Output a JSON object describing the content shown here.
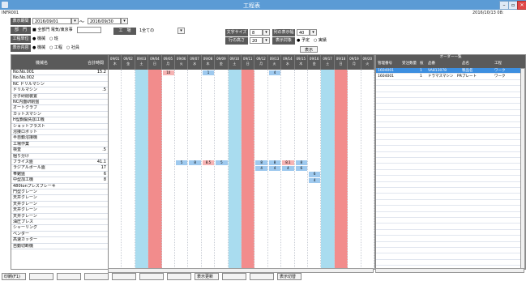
{
  "window": {
    "title": "工程表",
    "id": "INFR001",
    "datetime": "2016/10/13  08:"
  },
  "filters": {
    "period_label": "表示期間",
    "date_from": "2016/09/01",
    "tilde": "〜",
    "date_to": "2016/09/30",
    "dept_label": "部　門",
    "dept_options": "■ 全部門 電気/東京事",
    "dept_field": "",
    "factory_label": "工　場",
    "factory_value": "1全ての",
    "type_label": "工程単位",
    "type_options": "● 機械　○ 班",
    "display_label": "表示内容",
    "display_options": "● 機械　○ 工程　○ 社員",
    "font_label": "文字サイズ",
    "font_value": "8",
    "width_label": "列の表示幅",
    "width_value": "40",
    "rows_label": "行の高さ",
    "rows_value": "20",
    "target_label": "表示対象",
    "target_options": "● 予定　○ 実績",
    "show_button": "表示"
  },
  "left_grid": {
    "col_name": "機械名",
    "col_total": "合計時間",
    "rows": [
      {
        "name": "No.No.001",
        "total": "15.2"
      },
      {
        "name": "No.No.002",
        "total": ""
      },
      {
        "name": "NC ドリルマシン",
        "total": ""
      },
      {
        "name": "ドリルマシン",
        "total": ".5"
      },
      {
        "name": "分子研削装置",
        "total": ""
      },
      {
        "name": "NC内面研削盤",
        "total": ""
      },
      {
        "name": "オートクラブ",
        "total": ""
      },
      {
        "name": "カットスマシン",
        "total": ""
      },
      {
        "name": "H型鋼開先加工機",
        "total": ""
      },
      {
        "name": "ショットブラスト",
        "total": ""
      },
      {
        "name": "溶接ロボット",
        "total": ""
      },
      {
        "name": "半自動溶接機",
        "total": ""
      },
      {
        "name": "工場作業",
        "total": ""
      },
      {
        "name": "検査",
        "total": ".5"
      },
      {
        "name": "梱り分け",
        "total": ""
      },
      {
        "name": "フライス盤",
        "total": "41.1"
      },
      {
        "name": "ラジアルボール盤",
        "total": "17"
      },
      {
        "name": "帯鋸盤",
        "total": "6"
      },
      {
        "name": "中型加工機",
        "total": "8"
      },
      {
        "name": "480tonプレスブレーキ",
        "total": ""
      },
      {
        "name": "門型クレーン",
        "total": ""
      },
      {
        "name": "天井クレーン",
        "total": ""
      },
      {
        "name": "天井クレーン",
        "total": ""
      },
      {
        "name": "天井クレーン",
        "total": ""
      },
      {
        "name": "天井クレーン",
        "total": ""
      },
      {
        "name": "油圧プレス",
        "total": ""
      },
      {
        "name": "シャーリング",
        "total": ""
      },
      {
        "name": "ベンダー",
        "total": ""
      },
      {
        "name": "高速カッター",
        "total": ""
      },
      {
        "name": "自動切断機",
        "total": ""
      }
    ]
  },
  "days": [
    {
      "d": "09/01",
      "w": "木"
    },
    {
      "d": "09/02",
      "w": "金"
    },
    {
      "d": "09/03",
      "w": "土"
    },
    {
      "d": "09/04",
      "w": "日"
    },
    {
      "d": "09/05",
      "w": "月"
    },
    {
      "d": "09/06",
      "w": "火"
    },
    {
      "d": "09/07",
      "w": "水"
    },
    {
      "d": "09/08",
      "w": "木"
    },
    {
      "d": "09/09",
      "w": "金"
    },
    {
      "d": "09/10",
      "w": "土"
    },
    {
      "d": "09/11",
      "w": "日"
    },
    {
      "d": "09/12",
      "w": "月"
    },
    {
      "d": "09/13",
      "w": "火"
    },
    {
      "d": "09/14",
      "w": "水"
    },
    {
      "d": "09/15",
      "w": "木"
    },
    {
      "d": "09/16",
      "w": "金"
    },
    {
      "d": "09/17",
      "w": "土"
    },
    {
      "d": "09/18",
      "w": "日"
    },
    {
      "d": "09/19",
      "w": "月"
    },
    {
      "d": "09/20",
      "w": "火"
    }
  ],
  "schedule_cells": [
    {
      "row": 0,
      "day": 4,
      "text": "10",
      "kind": "pink"
    },
    {
      "row": 0,
      "day": 7,
      "text": "1",
      "kind": "blue"
    },
    {
      "row": 0,
      "day": 12,
      "text": "4",
      "kind": "blue"
    },
    {
      "row": 15,
      "day": 5,
      "text": "5",
      "kind": "blue"
    },
    {
      "row": 15,
      "day": 6,
      "text": "8",
      "kind": "blue"
    },
    {
      "row": 15,
      "day": 7,
      "text": "8.5",
      "kind": "pink"
    },
    {
      "row": 15,
      "day": 8,
      "text": "5",
      "kind": "blue"
    },
    {
      "row": 15,
      "day": 11,
      "text": "8",
      "kind": "blue"
    },
    {
      "row": 15,
      "day": 12,
      "text": "8",
      "kind": "blue"
    },
    {
      "row": 15,
      "day": 13,
      "text": "8.1",
      "kind": "pink"
    },
    {
      "row": 15,
      "day": 14,
      "text": "8",
      "kind": "blue"
    },
    {
      "row": 16,
      "day": 11,
      "text": "4",
      "kind": "blue"
    },
    {
      "row": 16,
      "day": 12,
      "text": "4",
      "kind": "blue"
    },
    {
      "row": 16,
      "day": 13,
      "text": "4",
      "kind": "blue"
    },
    {
      "row": 16,
      "day": 14,
      "text": "6",
      "kind": "blue"
    },
    {
      "row": 17,
      "day": 15,
      "text": "6",
      "kind": "blue"
    },
    {
      "row": 18,
      "day": 15,
      "text": "4",
      "kind": "blue"
    }
  ],
  "right_panel": {
    "title": "オーダー一覧",
    "columns": [
      "管理番号",
      "受注数量",
      "枝",
      "品番",
      "品名",
      "工程"
    ],
    "rows": [
      [
        "1604001",
        "",
        "1",
        "VA813078",
        "製品名",
        "ワーク"
      ],
      [
        "1604001",
        "",
        "1",
        "ドラマスマシン　PRC",
        "ブレート",
        "ワーク"
      ]
    ]
  },
  "bottom_buttons": [
    "印刷(F1)",
    "",
    "",
    "",
    "",
    "",
    "",
    "表示更新",
    "",
    "",
    "表示切替"
  ]
}
